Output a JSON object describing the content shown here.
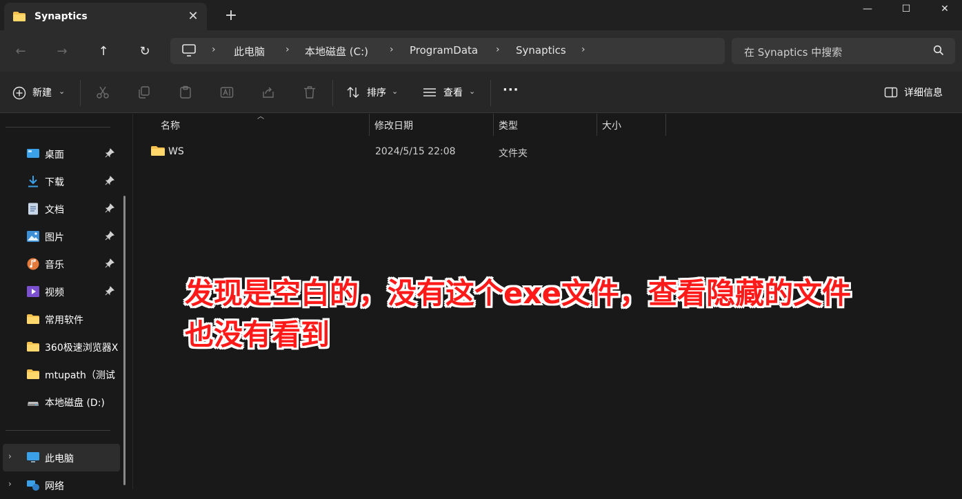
{
  "window": {
    "tab_title": "Synaptics",
    "tab_close": "✕",
    "new_tab": "+",
    "minimize": "—",
    "maximize": "☐",
    "close": "✕"
  },
  "nav": {
    "back": "←",
    "forward": "→",
    "up": "↑",
    "refresh": "↻",
    "breadcrumbs": [
      "此电脑",
      "本地磁盘 (C:)",
      "ProgramData",
      "Synaptics"
    ],
    "separator": "›",
    "search_placeholder": "在 Synaptics 中搜索"
  },
  "toolbar": {
    "new_label": "新建",
    "sort_label": "排序",
    "view_label": "查看",
    "more_label": "···",
    "details_label": "详细信息",
    "caret": "⌄"
  },
  "sidebar": {
    "quick_access": [
      {
        "label": "桌面",
        "icon": "desktop-icon",
        "pinned": true
      },
      {
        "label": "下载",
        "icon": "download-icon",
        "pinned": true
      },
      {
        "label": "文档",
        "icon": "documents-icon",
        "pinned": true
      },
      {
        "label": "图片",
        "icon": "pictures-icon",
        "pinned": true
      },
      {
        "label": "音乐",
        "icon": "music-icon",
        "pinned": true
      },
      {
        "label": "视频",
        "icon": "videos-icon",
        "pinned": true
      },
      {
        "label": "常用软件",
        "icon": "folder-icon",
        "pinned": false
      },
      {
        "label": "360极速浏览器X",
        "icon": "folder-icon",
        "pinned": false
      },
      {
        "label": "mtupath（测试",
        "icon": "folder-icon",
        "pinned": false
      },
      {
        "label": "本地磁盘 (D:)",
        "icon": "drive-icon",
        "pinned": false
      }
    ],
    "this_pc": "此电脑",
    "network": "网络"
  },
  "columns": {
    "name": "名称",
    "modified": "修改日期",
    "type": "类型",
    "size": "大小"
  },
  "files": [
    {
      "name": "WS",
      "modified": "2024/5/15 22:08",
      "type": "文件夹",
      "size": ""
    }
  ],
  "annotation": {
    "line1": "发现是空白的，没有这个exe文件，查看隐藏的文件",
    "line2": "也没有看到"
  },
  "colors": {
    "folder": "#f4c04e",
    "annotation": "#ff1a1a",
    "accent": "#4cc2ff"
  }
}
